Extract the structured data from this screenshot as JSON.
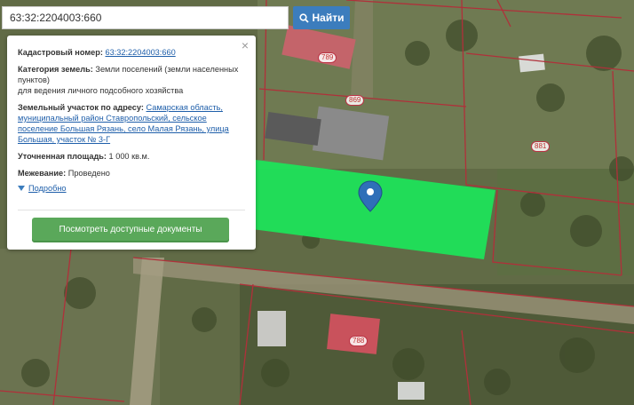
{
  "search": {
    "value": "63:32:2204003:660",
    "button_label": "Найти",
    "button_icon": "search-icon"
  },
  "info_panel": {
    "cadastral_label": "Кадастровый номер:",
    "cadastral_value": "63:32:2204003:660",
    "category_label": "Категория земель:",
    "category_value": "Земли поселений (земли населенных пунктов)",
    "category_use": "для ведения личного подсобного хозяйства",
    "address_label": "Земельный участок по адресу:",
    "address_value": "Самарская область, муниципальный район Ставропольский, сельское поселение Большая Рязань, село Малая Рязань, улица Большая, участок № 3-Г",
    "area_label": "Уточненная площадь:",
    "area_value": "1 000 кв.м.",
    "survey_label": "Межевание:",
    "survey_value": "Проведено",
    "details_label": "Подробно",
    "docs_button": "Посмотреть доступные документы",
    "close_icon": "×"
  },
  "map": {
    "plot_labels": [
      "789",
      "869",
      "881",
      "788"
    ],
    "highlight_color": "#1ee35a",
    "boundary_color": "#b0303a"
  }
}
